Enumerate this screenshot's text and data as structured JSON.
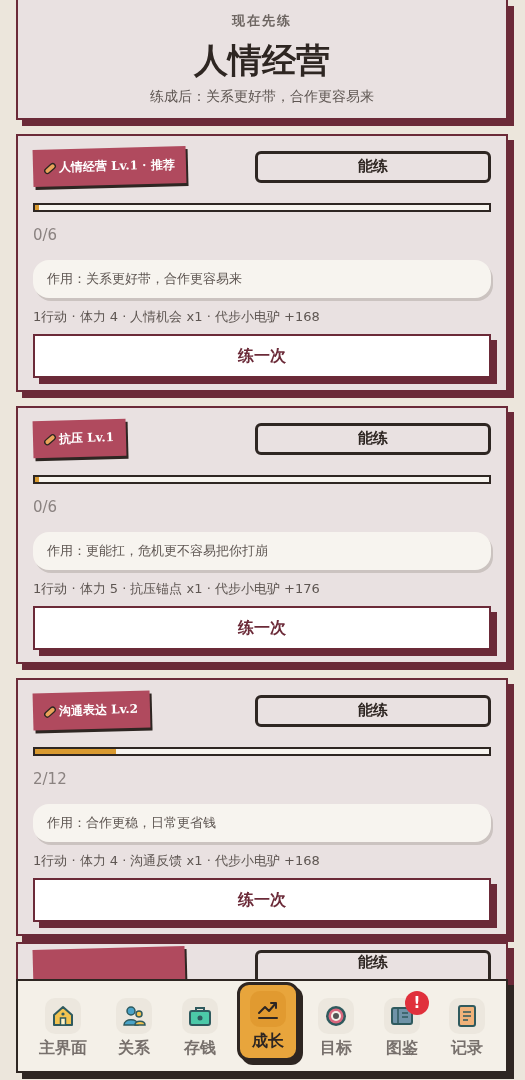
{
  "header": {
    "eyebrow": "现在先练",
    "title": "人情经营",
    "subtitle": "练成后：关系更好带，合作更容易来"
  },
  "cards": [
    {
      "kind": "full",
      "tag": "人情经营 Lv.1 · 推荐",
      "status": "能练",
      "level": 0,
      "count": "0/6",
      "effect": "作用：关系更好带，合作更容易来",
      "meta": "1行动 · 体力 4 · 人情机会 x1 · 代步小电驴 +168",
      "action": "练一次"
    },
    {
      "kind": "full",
      "tag": "抗压 Lv.1",
      "status": "能练",
      "level": 0,
      "count": "0/6",
      "effect": "作用：更能扛，危机更不容易把你打崩",
      "meta": "1行动 · 体力 5 · 抗压锚点 x1 · 代步小电驴 +176",
      "action": "练一次"
    },
    {
      "kind": "full",
      "tag": "沟通表达 Lv.2",
      "status": "能练",
      "level": 0.17,
      "count": "2/12",
      "effect": "作用：合作更稳，日常更省钱",
      "meta": "1行动 · 体力 4 · 沟通反馈 x1 · 代步小电驴 +168",
      "action": "练一次"
    },
    {
      "kind": "partial",
      "status": "能练"
    }
  ],
  "nav": [
    {
      "label": "主界面",
      "selected": false
    },
    {
      "label": "关系",
      "selected": false
    },
    {
      "label": "存钱",
      "selected": false
    },
    {
      "label": "成长",
      "selected": true
    },
    {
      "label": "目标",
      "selected": false
    },
    {
      "label": "图鉴",
      "selected": false,
      "badge": "!"
    },
    {
      "label": "记录",
      "selected": false
    }
  ]
}
